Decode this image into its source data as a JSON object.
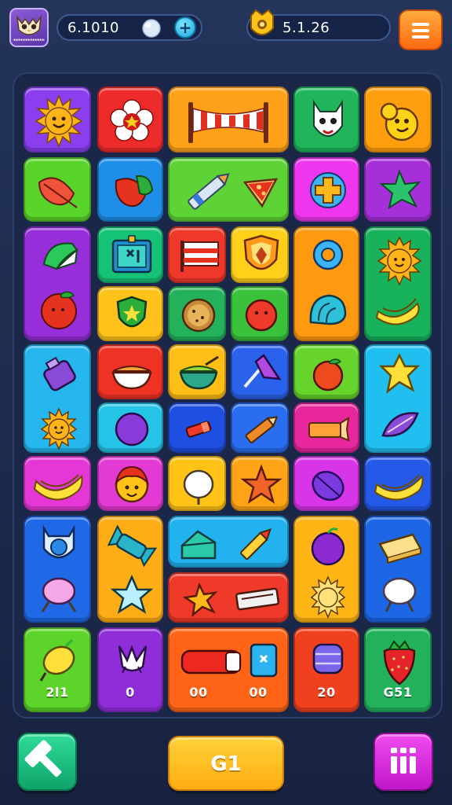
{
  "hud": {
    "coins": "6.1010",
    "stars": "5.1.26",
    "plus_label": "+",
    "avatar_caption": "▪▪▪▪▪▪▪▪▪▪▪▪▪▪▪▪"
  },
  "board": {
    "tiles": [
      {
        "id": "sun-1",
        "color": "#8a3ef0",
        "icon": "sun-icon"
      },
      {
        "id": "flower-1",
        "color": "#ee2b2b",
        "icon": "flower-icon"
      },
      {
        "id": "banner-1",
        "color": "#ffa21a",
        "icon": "banner-icon"
      },
      {
        "id": "mask-1",
        "color": "#20b55a",
        "icon": "mask-icon"
      },
      {
        "id": "creature-1",
        "color": "#ff9f0f",
        "icon": "creature-icon"
      },
      {
        "id": "leaf-1",
        "color": "#59d42a",
        "icon": "leaf-icon"
      },
      {
        "id": "leaf-2",
        "color": "#1f8ee8",
        "icon": "leaf-icon"
      },
      {
        "id": "crayon-pizza",
        "color": "#5ed335",
        "icon": "crayon-icon"
      },
      {
        "id": "cross-1",
        "color": "#ee36ee",
        "icon": "cross-icon"
      },
      {
        "id": "star-leaf",
        "color": "#a52fd8",
        "icon": "starleaf-icon"
      },
      {
        "id": "hat-apple",
        "color": "#962ed9",
        "icon": "hat-icon"
      },
      {
        "id": "frame-1",
        "color": "#16c276",
        "icon": "frame-icon"
      },
      {
        "id": "flag-1",
        "color": "#f0382a",
        "icon": "flag-icon"
      },
      {
        "id": "shield-1",
        "color": "#ffcf1a",
        "icon": "shield-icon"
      },
      {
        "id": "ring-shell",
        "color": "#ff9a10",
        "icon": "ring-icon"
      },
      {
        "id": "sun-banana",
        "color": "#19b25c",
        "icon": "sun-icon"
      },
      {
        "id": "shield-2",
        "color": "#ffc21a",
        "icon": "shield-icon"
      },
      {
        "id": "cookie-1",
        "color": "#23b159",
        "icon": "cookie-icon"
      },
      {
        "id": "ball-1",
        "color": "#39c23a",
        "icon": "ball-icon"
      },
      {
        "id": "jar-sun",
        "color": "#24b6ec",
        "icon": "jar-icon"
      },
      {
        "id": "bowl-1",
        "color": "#ee3324",
        "icon": "bowl-icon"
      },
      {
        "id": "bowl-2",
        "color": "#ffbe15",
        "icon": "bowl-icon"
      },
      {
        "id": "axe-1",
        "color": "#2a62ec",
        "icon": "axe-icon"
      },
      {
        "id": "apple-1",
        "color": "#66d42a",
        "icon": "apple-icon"
      },
      {
        "id": "star-seed",
        "color": "#20bff0",
        "icon": "star-icon"
      },
      {
        "id": "plum-1",
        "color": "#25c3e6",
        "icon": "plum-icon"
      },
      {
        "id": "candy-1",
        "color": "#1f4fe0",
        "icon": "candy-icon"
      },
      {
        "id": "crayon-1",
        "color": "#2a6df0",
        "icon": "crayon-icon"
      },
      {
        "id": "candy-2",
        "color": "#e8279e",
        "icon": "candy-icon"
      },
      {
        "id": "banana-1",
        "color": "#e537d6",
        "icon": "banana-icon"
      },
      {
        "id": "face-1",
        "color": "#e43ad4",
        "icon": "face-icon"
      },
      {
        "id": "egg-1",
        "color": "#ffc217",
        "icon": "egg-icon"
      },
      {
        "id": "starfish-1",
        "color": "#ffa416",
        "icon": "starfish-icon"
      },
      {
        "id": "plum-2",
        "color": "#d735e8",
        "icon": "plum-icon"
      },
      {
        "id": "banana-2",
        "color": "#2559e8",
        "icon": "banana-icon"
      },
      {
        "id": "ring-lolly",
        "color": "#1f69e6",
        "icon": "ring-icon"
      },
      {
        "id": "candy-star",
        "color": "#ffad17",
        "icon": "candy-icon"
      },
      {
        "id": "cake-pen",
        "color": "#22b2f0",
        "icon": "cake-icon"
      },
      {
        "id": "bug-bars",
        "color": "#ef3a2a",
        "icon": "bug-icon"
      },
      {
        "id": "plum-sun",
        "color": "#ffb515",
        "icon": "plum-icon"
      },
      {
        "id": "cheese-lolly",
        "color": "#1d66e6",
        "icon": "cheese-icon"
      },
      {
        "id": "lemon-1",
        "color": "#5cd42a",
        "icon": "lemon-icon"
      },
      {
        "id": "bird-1",
        "color": "#8f2ed8",
        "icon": "bird-icon"
      },
      {
        "id": "bat-1",
        "color": "#ff6417",
        "icon": "bat-icon"
      },
      {
        "id": "gem-1",
        "color": "#f0401e",
        "icon": "gem-icon"
      },
      {
        "id": "strawberry-1",
        "color": "#22b25c",
        "icon": "strawberry-icon"
      }
    ],
    "numbers": [
      "2l1",
      "0",
      "00",
      "00",
      "20",
      "G51"
    ]
  },
  "bottom": {
    "play_label": "G1"
  },
  "colors": {
    "background": "#1c2a4c",
    "board": "#1a2748",
    "accent_orange": "#ff8a1f",
    "accent_yellow": "#ffc21a",
    "accent_green": "#18c278",
    "accent_magenta": "#de2ee0"
  }
}
